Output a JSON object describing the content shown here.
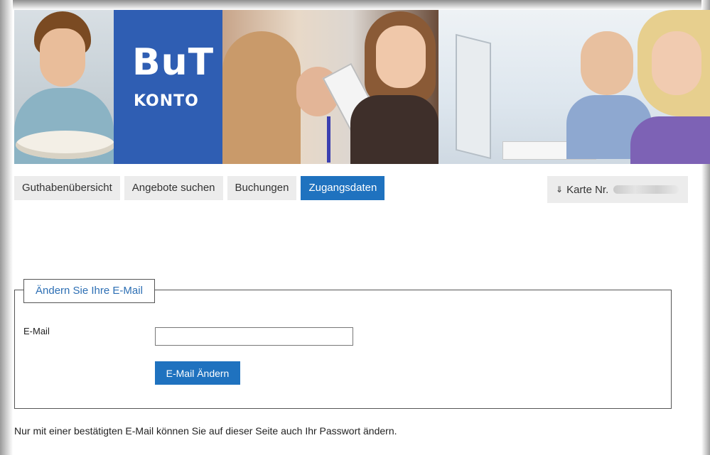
{
  "banner": {
    "logo_main": "BuT",
    "logo_sub": "KONTO"
  },
  "nav": {
    "tabs": [
      {
        "label": "Guthabenübersicht",
        "active": false
      },
      {
        "label": "Angebote suchen",
        "active": false
      },
      {
        "label": "Buchungen",
        "active": false
      },
      {
        "label": "Zugangsdaten",
        "active": true
      }
    ],
    "card": {
      "icon": "down-arrow-icon",
      "label": "Karte Nr."
    }
  },
  "email_form": {
    "legend": "Ändern Sie Ihre E-Mail",
    "field_label": "E-Mail",
    "field_value": "",
    "button_label": "E-Mail Ändern"
  },
  "footer_note": "Nur mit einer bestätigten E-Mail können Sie auf dieser Seite auch Ihr Passwort ändern.",
  "colors": {
    "accent": "#1f72bf",
    "logo_background": "#2f5eb3",
    "tab_background": "#ececec",
    "legend_text": "#2d6fb4"
  }
}
